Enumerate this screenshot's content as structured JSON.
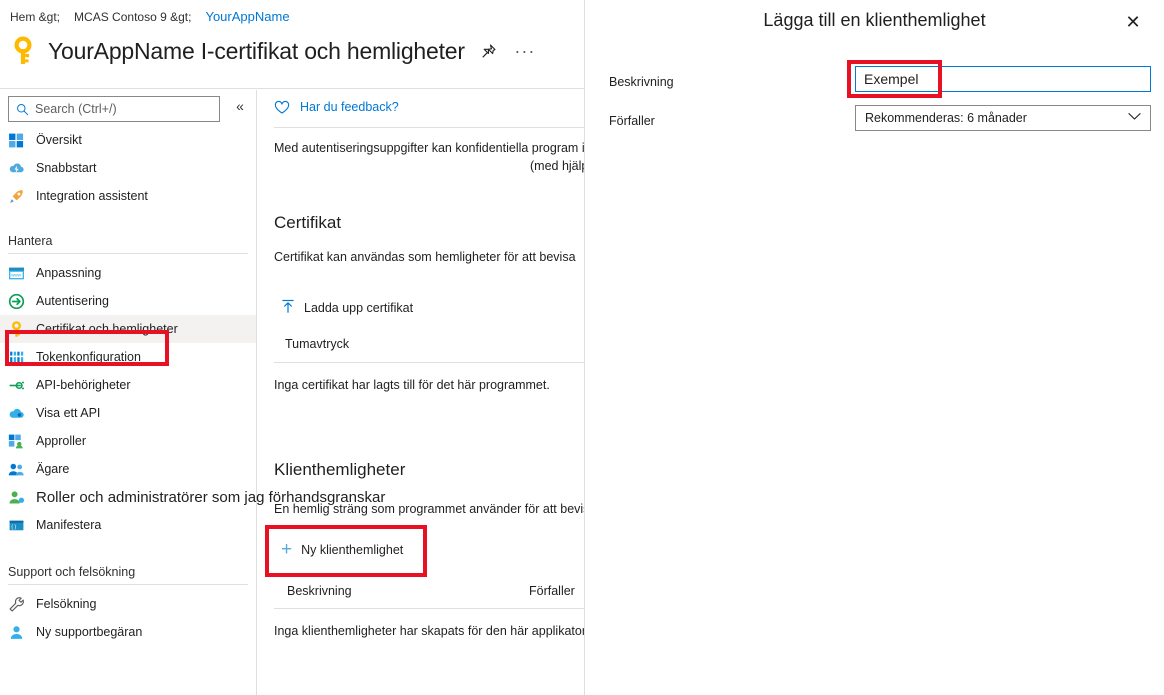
{
  "breadcrumb": {
    "items": [
      "Hem &gt;",
      "MCAS Contoso 9 &gt;"
    ],
    "current": "YourAppName"
  },
  "header": {
    "title": "YourAppName I-certifikat och hemligheter",
    "key_icon": "key-icon",
    "pin_icon": "pin-icon",
    "more_icon": "ellipsis-icon"
  },
  "search": {
    "placeholder": "Search (Ctrl+/)",
    "value": "",
    "icon": "search-icon",
    "collapse_icon": "double-chevron-left-icon"
  },
  "sidebar": {
    "items": [
      {
        "label": "Översikt",
        "icon": "overview-grid-icon",
        "selected": false
      },
      {
        "label": "Snabbstart",
        "icon": "cloud-lightning-icon",
        "selected": false
      },
      {
        "label": "Integration assistent",
        "icon": "rocket-icon",
        "selected": false
      }
    ],
    "group_manage": {
      "title": "Hantera",
      "items": [
        {
          "label": "Anpassning",
          "icon": "browser-window-icon",
          "selected": false
        },
        {
          "label": "Autentisering",
          "icon": "authentication-arrow-icon",
          "selected": false
        },
        {
          "label": "Certifikat och hemligheter",
          "icon": "key-icon",
          "selected": true
        },
        {
          "label": "Tokenkonfiguration",
          "icon": "token-bars-icon",
          "selected": false
        },
        {
          "label": "API-behörigheter",
          "icon": "api-connector-icon",
          "selected": false
        },
        {
          "label": "Visa ett API",
          "icon": "cloud-api-icon",
          "selected": false
        },
        {
          "label": "Approller",
          "icon": "app-roles-icon",
          "selected": false
        },
        {
          "label": "Ägare",
          "icon": "owners-people-icon",
          "selected": false
        },
        {
          "label": "Roller och administratörer som jag förhandsgranskar",
          "icon": "roles-admin-icon",
          "selected": false,
          "large": true
        },
        {
          "label": "Manifestera",
          "icon": "manifest-icon",
          "selected": false
        }
      ]
    },
    "group_support": {
      "title": "Support och felsökning",
      "items": [
        {
          "label": "Felsökning",
          "icon": "wrench-icon",
          "selected": false
        },
        {
          "label": "Ny supportbegäran",
          "icon": "support-person-icon",
          "selected": false
        }
      ]
    }
  },
  "main": {
    "feedback": {
      "label": "Har du feedback?",
      "icon": "heart-icon"
    },
    "intro_line1": "Med autentiseringsuppgifter kan konfidentiella program identifieras",
    "intro_line2": "(med hjälp av ett HTTPS-schema). För en högre nivå av betryggande",
    "certificates": {
      "heading": "Certifikat",
      "description": "Certifikat kan användas som hemligheter för att bevisa",
      "upload_button": {
        "label": "Ladda upp certifikat",
        "icon": "upload-arrow-icon"
      },
      "column_thumbprint": "Tumavtryck",
      "empty_text": "Inga certifikat har lagts till för det här programmet."
    },
    "client_secrets": {
      "heading": "Klienthemligheter",
      "description": "En hemlig sträng som programmet använder för att bevisa sin ide",
      "new_button": {
        "label": "Ny klienthemlighet",
        "icon": "plus-icon"
      },
      "column_description": "Beskrivning",
      "column_expires": "Förfaller",
      "empty_text": "Inga klienthemligheter har skapats för den här applikatorn"
    }
  },
  "panel": {
    "title": "Lägga till en klienthemlighet",
    "close_icon": "close-icon",
    "description_label": "Beskrivning",
    "description_value": "Exempel",
    "expires_label": "Förfaller",
    "expires_value": "Rekommenderas: 6 månader",
    "expires_chevron": "chevron-down-icon"
  },
  "colors": {
    "accent": "#0078d4",
    "annotation": "#e81123",
    "selected_row": "#f3f2f1",
    "divider": "#e1dfdd",
    "key_yellow": "#ffb900"
  }
}
